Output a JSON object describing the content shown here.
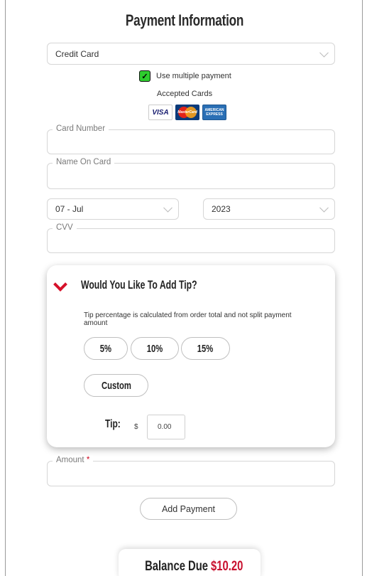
{
  "page": {
    "title": "Payment Information"
  },
  "payment_method": {
    "selected": "Credit Card"
  },
  "multiple_payment": {
    "label": "Use multiple payment",
    "checked": true,
    "check_glyph": "✓"
  },
  "accepted_cards": {
    "label": "Accepted Cards",
    "cards": [
      {
        "name": "visa",
        "text": "VISA"
      },
      {
        "name": "mastercard",
        "text": "MasterCard"
      },
      {
        "name": "amex",
        "text_line1": "AMERICAN",
        "text_line2": "EXPRESS"
      }
    ]
  },
  "fields": {
    "card_number": {
      "label": "Card Number",
      "value": ""
    },
    "name_on_card": {
      "label": "Name On Card",
      "value": ""
    },
    "expiry_month": {
      "selected": "07 - Jul"
    },
    "expiry_year": {
      "selected": "2023"
    },
    "cvv": {
      "label": "CVV",
      "value": ""
    }
  },
  "tip": {
    "heading": "Would You Like To Add Tip?",
    "description": "Tip percentage is calculated from order total and not split payment amount",
    "options": [
      "5%",
      "10%",
      "15%"
    ],
    "custom_label": "Custom",
    "tip_label": "Tip:",
    "currency": "$",
    "value": "0.00"
  },
  "amount": {
    "label": "Amount",
    "required_mark": "*",
    "value": ""
  },
  "add_payment": {
    "label": "Add Payment"
  },
  "balance": {
    "label": "Balance Due",
    "amount": "$10.20"
  },
  "colors": {
    "accent": "#d6112a",
    "checkbox": "#2ecc2e",
    "balance_amount": "#c8102e"
  }
}
